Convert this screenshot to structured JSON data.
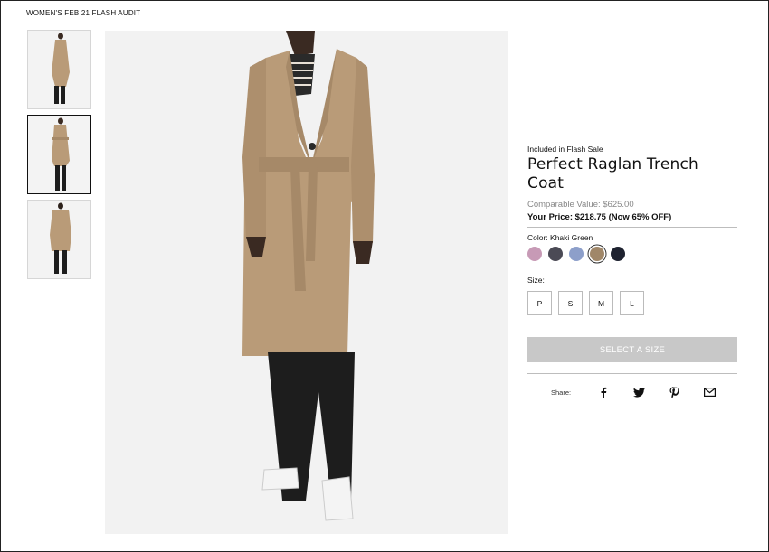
{
  "breadcrumb": "WOMEN'S FEB 21 FLASH AUDIT",
  "thumbnails": [
    {
      "alt": "front view",
      "active": false
    },
    {
      "alt": "belted view",
      "active": true
    },
    {
      "alt": "back view",
      "active": false
    }
  ],
  "product": {
    "flash_label": "Included in Flash Sale",
    "title": "Perfect Raglan Trench Coat",
    "comparable": "Comparable Value: $625.00",
    "price": "Your Price: $218.75 (Now 65% OFF)",
    "color_label": "Color:  Khaki Green",
    "colors": [
      {
        "name": "mauve",
        "hex": "#c79ab6"
      },
      {
        "name": "charcoal",
        "hex": "#4b4a55"
      },
      {
        "name": "periwinkle",
        "hex": "#8d9fca"
      },
      {
        "name": "khaki green",
        "hex": "#a08769"
      },
      {
        "name": "navy",
        "hex": "#1e2230"
      }
    ],
    "selected_color": 3,
    "size_label": "Size:",
    "sizes": [
      "P",
      "S",
      "M",
      "L"
    ],
    "cta": "SELECT A SIZE",
    "share_label": "Share:",
    "share_icons": [
      "facebook-icon",
      "twitter-icon",
      "pinterest-icon",
      "email-icon"
    ]
  },
  "colors": {
    "coat": "#b99b78",
    "pants": "#1d1d1d",
    "image_bg": "#f2f2f2",
    "cta_bg": "#c8c8c8"
  }
}
